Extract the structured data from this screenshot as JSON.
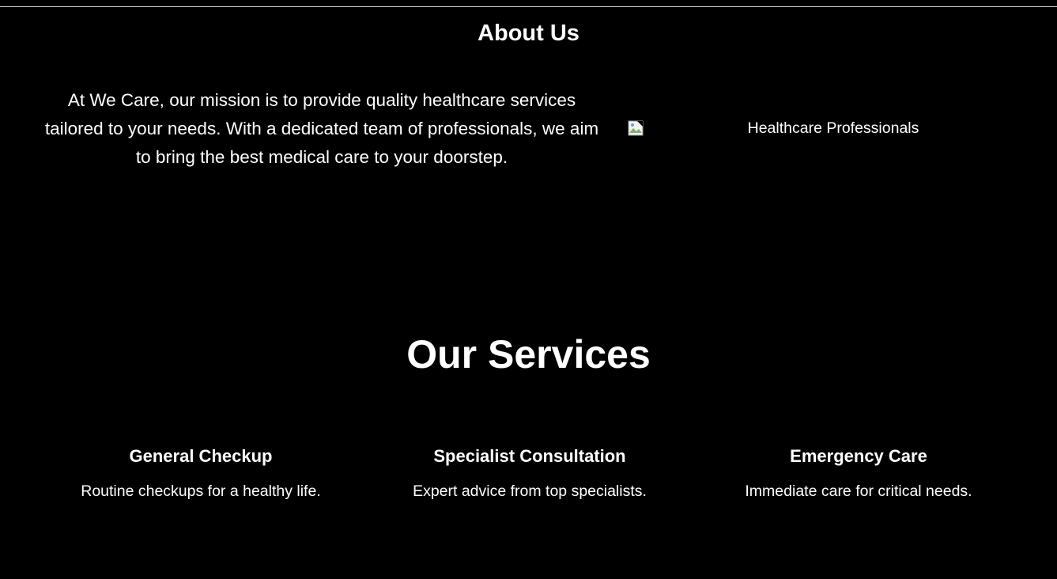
{
  "about": {
    "title": "About Us",
    "text": "At We Care, our mission is to provide quality healthcare services tailored to your needs. With a dedicated team of professionals, we aim to bring the best medical care to your doorstep.",
    "image_alt": "Healthcare Professionals",
    "image_icon": "broken-image-icon"
  },
  "services": {
    "title": "Our Services",
    "items": [
      {
        "title": "General Checkup",
        "description": "Routine checkups for a healthy life."
      },
      {
        "title": "Specialist Consultation",
        "description": "Expert advice from top specialists."
      },
      {
        "title": "Emergency Care",
        "description": "Immediate care for critical needs."
      }
    ]
  },
  "colors": {
    "background": "#000000",
    "text": "#ffffff",
    "rule": "#d9d9d9"
  }
}
